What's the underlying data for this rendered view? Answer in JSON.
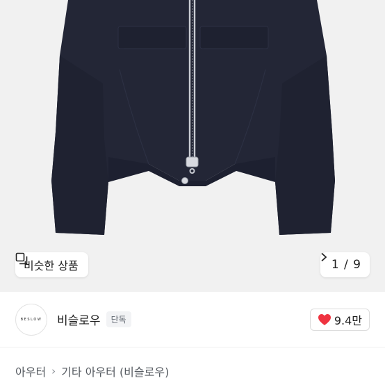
{
  "gallery": {
    "similar_label": "비슷한 상품",
    "pager": "1 / 9"
  },
  "shop": {
    "logo_text": "BESLOW",
    "name": "비슬로우",
    "badge": "단독",
    "likes": "9.4만"
  },
  "breadcrumb": {
    "items": [
      "아우터",
      "기타 아우터 (비슬로우)"
    ]
  },
  "colors": {
    "hero_bg": "#f1f1f1",
    "jacket": "#232636",
    "heart": "#ef3340"
  },
  "icons": [
    "similar-items-icon",
    "chevron-right-icon",
    "heart-icon"
  ]
}
